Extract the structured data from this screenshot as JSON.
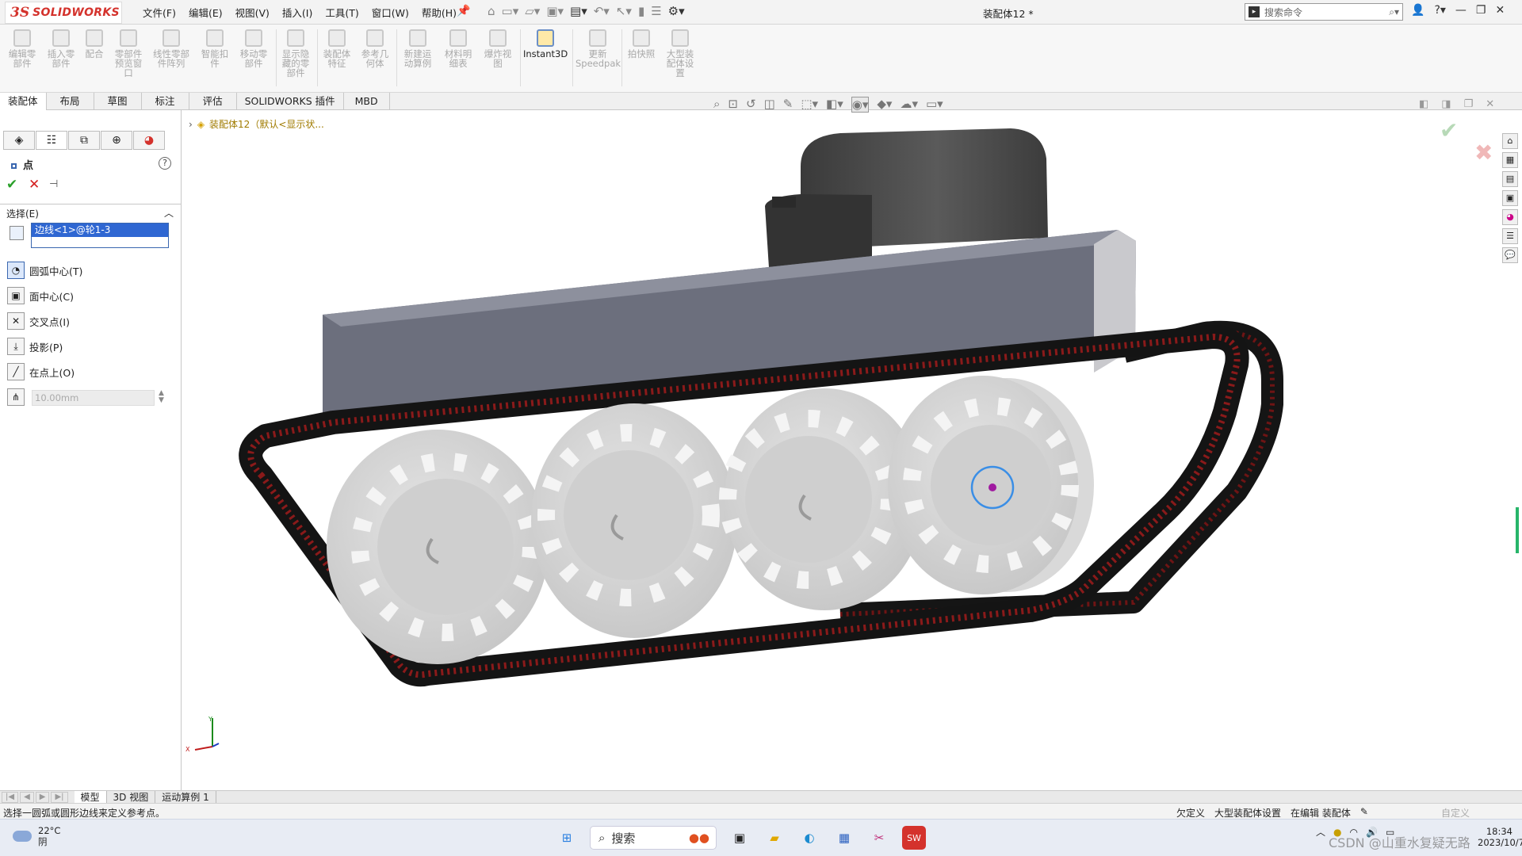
{
  "app": {
    "brand_ds": "3S",
    "brand_name": "SOLIDWORKS",
    "document_title": "装配体12 *"
  },
  "menu": [
    "文件(F)",
    "编辑(E)",
    "视图(V)",
    "插入(I)",
    "工具(T)",
    "窗口(W)",
    "帮助(H)"
  ],
  "search": {
    "placeholder": "搜索命令"
  },
  "ribbon": [
    {
      "label": "编辑零\n部件"
    },
    {
      "label": "插入零\n部件"
    },
    {
      "label": "配合"
    },
    {
      "label": "零部件\n预览窗\n口"
    },
    {
      "label": "线性零部\n件阵列"
    },
    {
      "label": "智能扣\n件"
    },
    {
      "label": "移动零\n部件"
    },
    {
      "label": "显示隐\n藏的零\n部件"
    },
    {
      "label": "装配体\n特征"
    },
    {
      "label": "参考几\n何体"
    },
    {
      "label": "新建运\n动算例"
    },
    {
      "label": "材料明\n细表"
    },
    {
      "label": "爆炸视\n图"
    },
    {
      "label": "Instant3D"
    },
    {
      "label": "更新\nSpeedpak"
    },
    {
      "label": "拍快照"
    },
    {
      "label": "大型装\n配体设\n置"
    }
  ],
  "tabs": [
    "装配体",
    "布局",
    "草图",
    "标注",
    "评估",
    "SOLIDWORKS 插件",
    "MBD"
  ],
  "property_manager": {
    "title": "点",
    "help": "?",
    "selection_header": "选择(E)",
    "selected_item": "边线<1>@轮1-3",
    "options": [
      "圆弧中心(T)",
      "面中心(C)",
      "交叉点(I)",
      "投影(P)",
      "在点上(O)"
    ],
    "distance_value": "10.00mm"
  },
  "tree": {
    "label": "装配体12（默认<显示状..."
  },
  "axes": {
    "x": "X",
    "y": "Y"
  },
  "bottom_tabs": [
    "模型",
    "3D 视图",
    "运动算例 1"
  ],
  "status": {
    "message": "选择一圆弧或圆形边线来定义参考点。",
    "right": [
      "欠定义",
      "大型装配体设置",
      "在编辑 装配体"
    ],
    "custom": "自定义"
  },
  "taskbar": {
    "temperature": "22°C",
    "weather": "阴",
    "search": "搜索",
    "time": "18:34",
    "date": "2023/10/7",
    "watermark": "CSDN @山重水复疑无路"
  },
  "colors": {
    "accent": "#2f67d2",
    "brand": "#d4322c",
    "selection": "#3a8ee6",
    "track_red": "#8a1a1a"
  }
}
